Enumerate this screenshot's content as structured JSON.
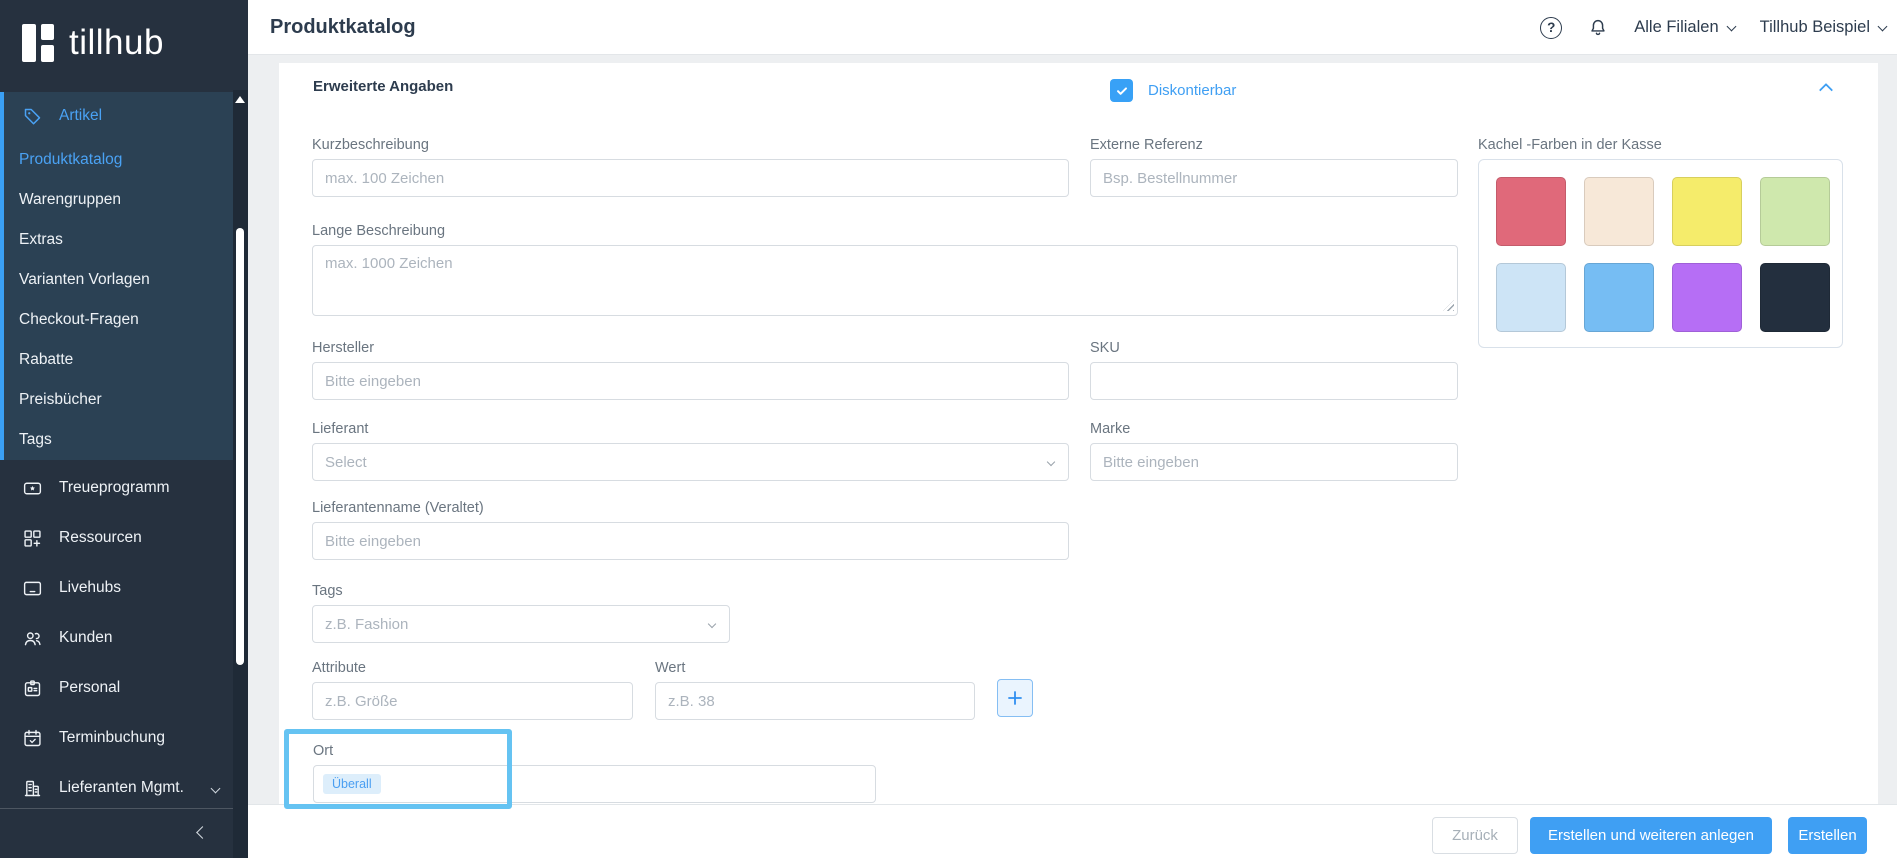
{
  "colors": {
    "accent": "#3f9ff3",
    "highlight_border": "#65c3f2",
    "sidebar_active": "#4aa2f4",
    "checkbox_blue": "#38a1f6"
  },
  "sidebar": {
    "logo_text": "tillhub",
    "group_label": "Artikel",
    "group_items": [
      "Produktkatalog",
      "Warengruppen",
      "Extras",
      "Varianten Vorlagen",
      "Checkout-Fragen",
      "Rabatte",
      "Preisbücher",
      "Tags"
    ],
    "menu_items": [
      {
        "label": "Treueprogramm",
        "icon": "ticket-icon"
      },
      {
        "label": "Ressourcen",
        "icon": "resources-grid-icon"
      },
      {
        "label": "Livehubs",
        "icon": "display-icon"
      },
      {
        "label": "Kunden",
        "icon": "users-icon"
      },
      {
        "label": "Personal",
        "icon": "id-badge-icon"
      },
      {
        "label": "Terminbuchung",
        "icon": "calendar-check-icon"
      },
      {
        "label": "Lieferanten Mgmt.",
        "icon": "building-icon"
      }
    ]
  },
  "header": {
    "title": "Produktkatalog",
    "help_glyph": "?",
    "branch_selector": "Alle Filialen",
    "account_selector": "Tillhub Beispiel"
  },
  "section": {
    "title": "Erweiterte Angaben",
    "checkbox_label": "Diskontierbar",
    "checkbox_checked": "true"
  },
  "form": {
    "kurzbeschreibung": {
      "label": "Kurzbeschreibung",
      "placeholder": "max. 100 Zeichen"
    },
    "externe_referenz": {
      "label": "Externe Referenz",
      "placeholder": "Bsp. Bestellnummer"
    },
    "kachel_farben": {
      "label": "Kachel -Farben in der Kasse",
      "colors": [
        "#e0697a",
        "#f7e8d8",
        "#f5ec6b",
        "#cfe8ad",
        "#cde4f6",
        "#76bdf3",
        "#b66ef5",
        "#232f3e"
      ]
    },
    "lange_beschreibung": {
      "label": "Lange Beschreibung",
      "placeholder": "max. 1000 Zeichen"
    },
    "hersteller": {
      "label": "Hersteller",
      "placeholder": "Bitte eingeben"
    },
    "sku": {
      "label": "SKU",
      "placeholder": ""
    },
    "lieferant": {
      "label": "Lieferant",
      "placeholder": "Select"
    },
    "marke": {
      "label": "Marke",
      "placeholder": "Bitte eingeben"
    },
    "lieferantenname": {
      "label": "Lieferantenname (Veraltet)",
      "placeholder": "Bitte eingeben"
    },
    "tags": {
      "label": "Tags",
      "placeholder": "z.B. Fashion"
    },
    "attribute": {
      "label": "Attribute",
      "placeholder": "z.B. Größe"
    },
    "wert": {
      "label": "Wert",
      "placeholder": "z.B. 38"
    },
    "ort": {
      "label": "Ort",
      "tag": "Überall"
    }
  },
  "footer": {
    "back": "Zurück",
    "create_and_next": "Erstellen und weiteren anlegen",
    "create": "Erstellen"
  }
}
